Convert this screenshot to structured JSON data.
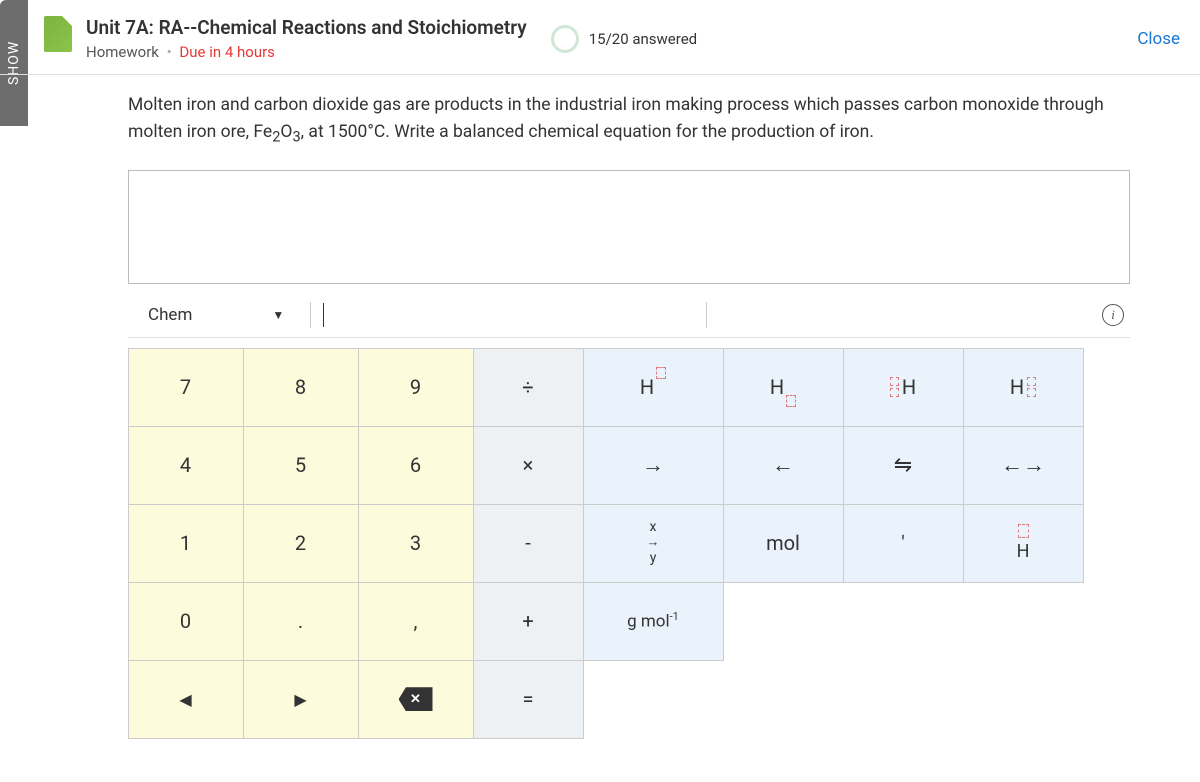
{
  "sidebar": {
    "show_label": "SHOW"
  },
  "header": {
    "title": "Unit 7A: RA--Chemical Reactions and Stoichiometry",
    "subtitle_type": "Homework",
    "due_text": "Due in 4 hours",
    "progress_text": "15/20 answered",
    "close_label": "Close"
  },
  "question": {
    "text_pre": "Molten iron and carbon dioxide gas are products in the industrial iron making process which passes carbon monoxide through molten iron ore, Fe",
    "formula_sub1": "2",
    "formula_mid": "O",
    "formula_sub2": "3",
    "text_post": ", at 1500°C.  Write a balanced chemical equation for the production of iron."
  },
  "answer": {
    "value": ""
  },
  "toolbar": {
    "mode_label": "Chem"
  },
  "keypad": {
    "r1": {
      "c1": "7",
      "c2": "8",
      "c3": "9",
      "c4": "÷",
      "c5": "H",
      "c6": "H",
      "c7": "H",
      "c8": "H"
    },
    "r2": {
      "c1": "4",
      "c2": "5",
      "c3": "6",
      "c4": "×",
      "c5": "→",
      "c6": "←",
      "c7": "⇋",
      "c8": "←→"
    },
    "r3": {
      "c1": "1",
      "c2": "2",
      "c3": "3",
      "c4": "-",
      "c5x": "x",
      "c5a": "→",
      "c5y": "y",
      "c6": "mol",
      "c7": "'",
      "c8": "H"
    },
    "r4": {
      "c1": "0",
      "c2": ".",
      "c3": ",",
      "c4": "+",
      "c5": "g mol",
      "c5sup": "-1"
    },
    "r5": {
      "c1": "◀",
      "c2": "▶",
      "c3": "✕",
      "c4": "="
    }
  }
}
